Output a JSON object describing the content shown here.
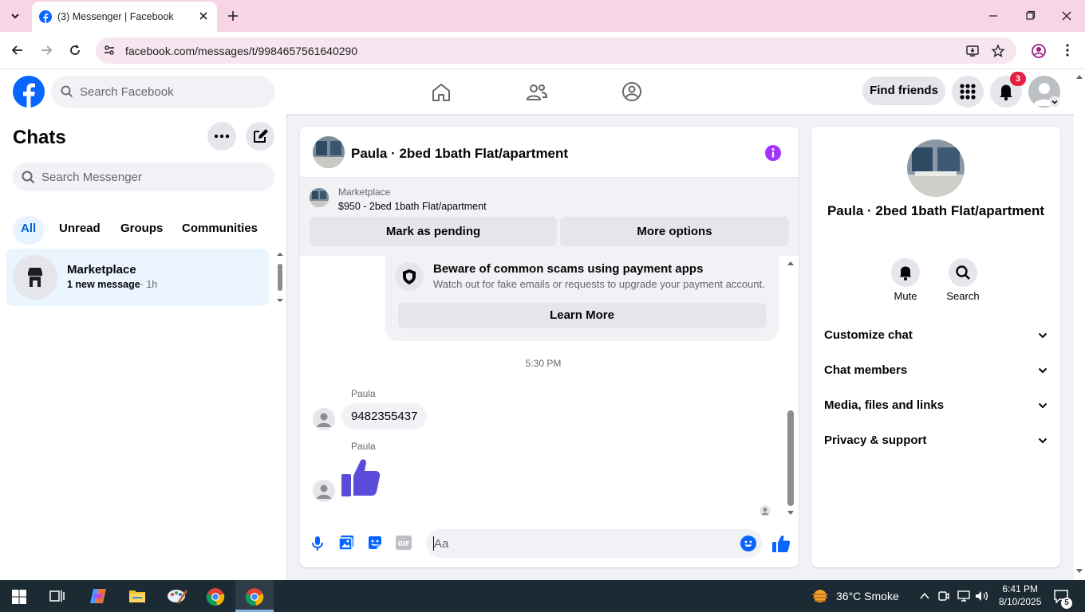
{
  "browser": {
    "tab_title": "(3) Messenger | Facebook",
    "url": "facebook.com/messages/t/9984657561640290"
  },
  "header": {
    "search_placeholder": "Search Facebook",
    "find_friends_label": "Find friends",
    "notification_count": "3"
  },
  "chats": {
    "title": "Chats",
    "search_placeholder": "Search Messenger",
    "filters": [
      "All",
      "Unread",
      "Groups",
      "Communities"
    ],
    "items": [
      {
        "name": "Marketplace",
        "preview": "1 new message",
        "time": "· 1h"
      }
    ]
  },
  "conversation": {
    "title": "Paula · 2bed 1bath Flat/apartment",
    "marketplace_label": "Marketplace",
    "marketplace_item": "$950 - 2bed 1bath Flat/apartment",
    "mark_pending_label": "Mark as pending",
    "more_options_label": "More options",
    "scam_title": "Beware of common scams using payment apps",
    "scam_text": "Watch out for fake emails or requests to upgrade your payment account.",
    "learn_more_label": "Learn More",
    "timestamp": "5:30 PM",
    "messages": [
      {
        "sender": "Paula",
        "text": "9482355437"
      },
      {
        "sender": "Paula",
        "text": ""
      }
    ],
    "composer_placeholder": "Aa"
  },
  "info": {
    "name": "Paula · 2bed 1bath Flat/apartment",
    "actions": [
      "Mute",
      "Search"
    ],
    "sections": [
      "Customize chat",
      "Chat members",
      "Media, files and links",
      "Privacy & support"
    ]
  },
  "taskbar": {
    "weather": "36°C  Smoke",
    "time": "6:41 PM",
    "date": "8/10/2025",
    "notification_count": "5"
  },
  "colors": {
    "fb_blue": "#0866ff",
    "messenger_purple": "#8a2be2",
    "thumbs_purple": "#5b4bdb",
    "tabbar_pink": "#f7d4e6"
  }
}
